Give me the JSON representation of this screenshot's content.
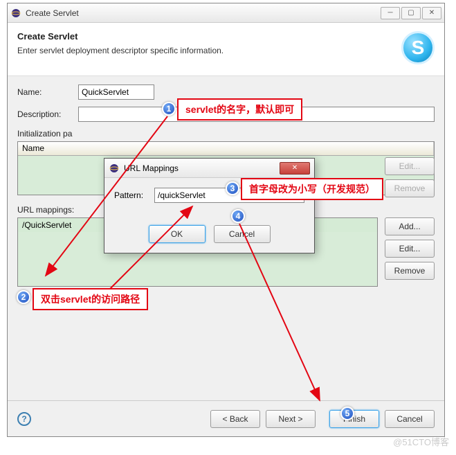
{
  "main": {
    "title": "Create Servlet",
    "header_title": "Create Servlet",
    "header_sub": "Enter servlet deployment descriptor specific information.",
    "name_label": "Name:",
    "name_value": "QuickServlet",
    "description_label": "Description:",
    "description_value": "",
    "init_params_label": "Initialization pa",
    "init_table_col_name": "Name",
    "url_mappings_label": "URL mappings:",
    "url_mapping_value": "/QuickServlet",
    "buttons": {
      "add": "Add...",
      "edit": "Edit...",
      "remove": "Remove",
      "back": "< Back",
      "next": "Next >",
      "finish": "Finish",
      "cancel": "Cancel"
    }
  },
  "dialog": {
    "title": "URL Mappings",
    "pattern_label": "Pattern:",
    "pattern_value": "/quickServlet",
    "ok": "OK",
    "cancel": "Cancel"
  },
  "annotations": {
    "a1": "servlet的名字，默认即可",
    "a2": "双击servlet的访问路径",
    "a3": "首字母改为小写（开发规范）"
  },
  "watermark": "@51CTO博客"
}
